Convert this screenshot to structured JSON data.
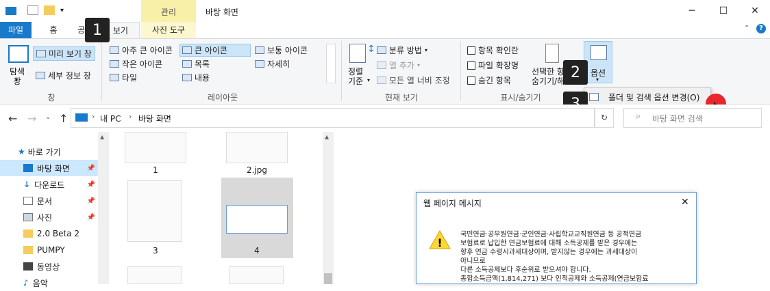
{
  "titlebar": {
    "context_tab": "관리",
    "title": "바탕 화면"
  },
  "tabs": {
    "file": "파일",
    "home": "홈",
    "share": "공유",
    "view": "보기",
    "picture_tools": "사진 도구"
  },
  "ribbon": {
    "pane": {
      "nav_pane": "탐색\n창",
      "preview": "미리 보기 창",
      "details": "세부 정보 창",
      "label": "창"
    },
    "layout": {
      "xl_icons": "아주 큰 아이콘",
      "large_icons": "큰 아이콘",
      "medium_icons": "보통 아이콘",
      "small_icons": "작은 아이콘",
      "list": "목록",
      "details": "자세히",
      "tiles": "타일",
      "content": "내용",
      "label": "레이아웃"
    },
    "current_view": {
      "sort": "정렬\n기준",
      "group_by": "분류 방법",
      "add_column": "열 추가",
      "fit_columns": "모든 열 너비 조정",
      "label": "현재 보기"
    },
    "show_hide": {
      "item_checkbox": "항목 확인란",
      "file_ext": "파일 확장명",
      "hidden_items": "숨긴 항목",
      "hide_selected": "선택한 항목\n숨기기/해",
      "label": "표시/숨기기"
    },
    "options": {
      "label": "옵션",
      "dropdown_item": "폴더 및 검색 옵션 변경(O)"
    }
  },
  "badges": [
    "1",
    "2",
    "3"
  ],
  "address": {
    "thispc": "내 PC",
    "current": "바탕 화면",
    "search_placeholder": "바탕 화면 검색"
  },
  "nav": {
    "items": [
      {
        "label": "바로 가기",
        "icon": "star-icon"
      },
      {
        "label": "바탕 화면",
        "icon": "desktop-icon",
        "pinned": true
      },
      {
        "label": "다운로드",
        "icon": "download-icon",
        "pinned": true
      },
      {
        "label": "문서",
        "icon": "document-icon",
        "pinned": true
      },
      {
        "label": "사진",
        "icon": "picture-icon",
        "pinned": true
      },
      {
        "label": "2.0 Beta 2",
        "icon": "folder-icon"
      },
      {
        "label": "PUMPY",
        "icon": "folder-icon"
      },
      {
        "label": "동영상",
        "icon": "video-icon"
      },
      {
        "label": "음악",
        "icon": "music-icon"
      }
    ]
  },
  "files": [
    "1",
    "2.jpg",
    "3",
    "4"
  ],
  "dialog": {
    "title": "웹 페이지 메시지",
    "lines": [
      "국민연금·공무원연금·군인연금·사립학교교직원연금 등 공적연금",
      "보험료로 납입한 연금보험료에 대해 소득공제를 받은 경우에는",
      "향후 연금 수령시과세대상이며, 받지않는 경우에는 과세대상이",
      "아니므로",
      "다른 소득공제보다 후순위로 받으셔야 합니다.",
      "종합소득금액(1,814,271) 보다 인적공제와 소득공제(연금보험료"
    ]
  },
  "colors": {
    "accent": "#1979ca",
    "selection": "#cce4f7",
    "cursor_dot": "#e8262d"
  }
}
